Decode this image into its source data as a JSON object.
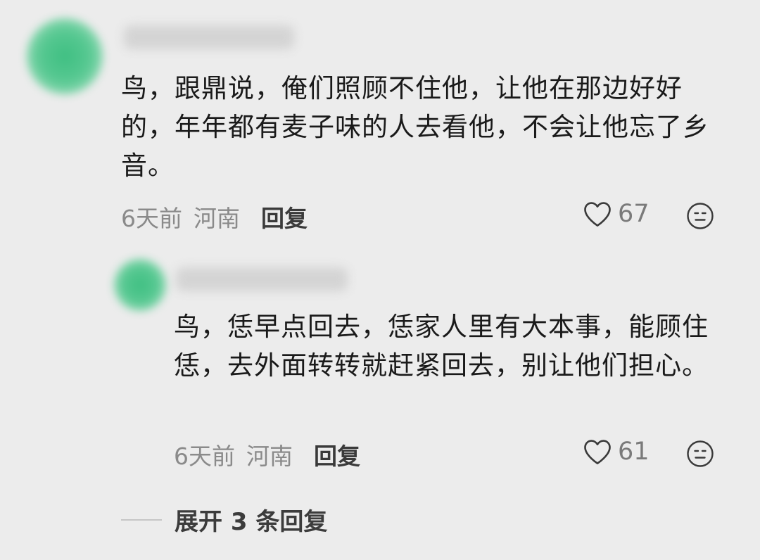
{
  "comment": {
    "text": "鸟，跟鼎说，俺们照顾不住他，让他在那边好好的，年年都有麦子味的人去看他，不会让他忘了乡音。",
    "time": "6天前",
    "location": "河南",
    "reply_label": "回复",
    "likes": "67"
  },
  "reply": {
    "text": "鸟，恁早点回去，恁家人里有大本事，能顾住恁，去外面转转就赶紧回去，别让他们担心。",
    "time": "6天前",
    "location": "河南",
    "reply_label": "回复",
    "likes": "61"
  },
  "expand_label": "展开 3 条回复",
  "colors": {
    "background": "#ececec",
    "avatar": "#3fbf82",
    "meta_text": "#8a8a8a"
  },
  "icons": [
    "heart-icon",
    "neutral-face-icon"
  ]
}
